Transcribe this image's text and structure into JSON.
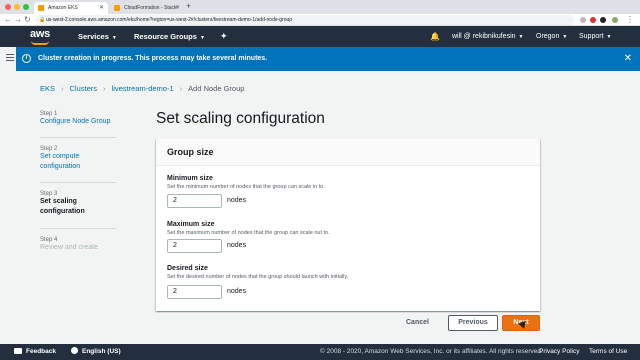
{
  "browser": {
    "tabs": [
      {
        "title": "Amazon EKS"
      },
      {
        "title": "CloudFormation - Stack"
      }
    ],
    "url": "us-west-2.console.aws.amazon.com/eks/home?region=us-west-2#/clusters/livestream-demo-1/add-node-group"
  },
  "nav": {
    "logo": "aws",
    "services": "Services",
    "resource_groups": "Resource Groups",
    "user": "will @ rekibnikufesin",
    "region": "Oregon",
    "support": "Support"
  },
  "banner": {
    "message": "Cluster creation in progress. This process may take several minutes.",
    "color": "#0073bb"
  },
  "breadcrumb": [
    "EKS",
    "Clusters",
    "livestream-demo-1",
    "Add Node Group"
  ],
  "steps": [
    {
      "num": "Step 1",
      "label": "Configure Node Group"
    },
    {
      "num": "Step 2",
      "label": "Set compute configuration"
    },
    {
      "num": "Step 3",
      "label": "Set scaling configuration"
    },
    {
      "num": "Step 4",
      "label": "Review and create"
    }
  ],
  "page_title": "Set scaling configuration",
  "group_size": {
    "heading": "Group size",
    "fields": [
      {
        "label": "Minimum size",
        "desc": "Set the minimum number of nodes that the group can scale in to.",
        "value": "2",
        "unit": "nodes"
      },
      {
        "label": "Maximum size",
        "desc": "Set the maximum number of nodes that the group can scale out to.",
        "value": "2",
        "unit": "nodes"
      },
      {
        "label": "Desired size",
        "desc": "Set the desired number of nodes that the group should launch with initially.",
        "value": "2",
        "unit": "nodes"
      }
    ]
  },
  "actions": {
    "cancel": "Cancel",
    "previous": "Previous",
    "next": "Next",
    "primary_color": "#ec7211"
  },
  "footer": {
    "feedback": "Feedback",
    "language": "English (US)",
    "copyright": "© 2008 - 2020, Amazon Web Services, Inc. or its affiliates. All rights reserved.",
    "privacy": "Privacy Policy",
    "terms": "Terms of Use"
  }
}
